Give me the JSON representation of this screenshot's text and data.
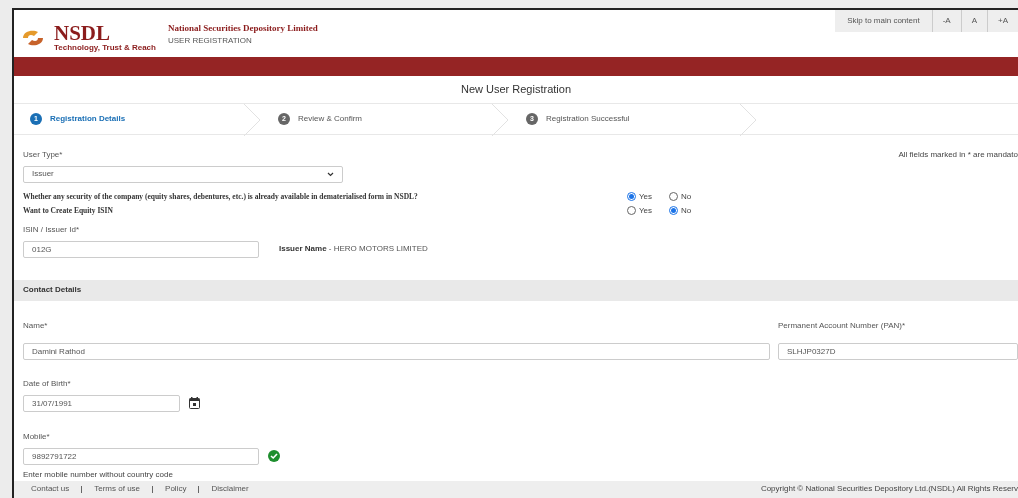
{
  "header": {
    "logo_text": "NSDL",
    "logo_tagline": "Technology, Trust & Reach",
    "org_name": "National Securities Depository Limited",
    "subtitle": "USER REGISTRATION",
    "accessibility_links": [
      "Skip to main content",
      "-A",
      "A",
      "+A"
    ]
  },
  "page_title": "New User Registration",
  "steps": [
    {
      "number": "1",
      "label": "Registration Details",
      "selected": true
    },
    {
      "number": "2",
      "label": "Review & Confirm",
      "selected": false
    },
    {
      "number": "3",
      "label": "Registration Successful",
      "selected": false
    }
  ],
  "mandatory_note": "All fields marked in * are mandato",
  "user_type": {
    "label": "User Type*",
    "value": "Issuer"
  },
  "questions": [
    {
      "text": "Whether any security of the company (equity shares, debentures, etc.) is already available in dematerialised form in NSDL?",
      "options": [
        {
          "label": "Yes",
          "selected": true
        },
        {
          "label": "No",
          "selected": false
        }
      ]
    },
    {
      "text": "Want to Create Equity ISIN",
      "options": [
        {
          "label": "Yes",
          "selected": false
        },
        {
          "label": "No",
          "selected": true
        }
      ]
    }
  ],
  "isin": {
    "label": "ISIN / Issuer Id*",
    "value": "012G",
    "issuer_name_label": "Issuer Name",
    "issuer_name_value": " - HERO MOTORS LIMITED"
  },
  "contact_section": "Contact Details",
  "name": {
    "label": "Name*",
    "value": "Damini Rathod"
  },
  "pan": {
    "label": "Permanent Account Number (PAN)*",
    "value": "SLHJP0327D"
  },
  "dob": {
    "label": "Date of Birth*",
    "value": "31/07/1991"
  },
  "mobile": {
    "label": "Mobile*",
    "value": "9892791722",
    "verified": true,
    "hint": "Enter mobile number without country code"
  },
  "footer": {
    "links": [
      "Contact us",
      "Terms of use",
      "Policy",
      "Disclaimer"
    ],
    "copyright": "Copyright © National Securities Depository Ltd.(NSDL) All Rights Reserv"
  }
}
